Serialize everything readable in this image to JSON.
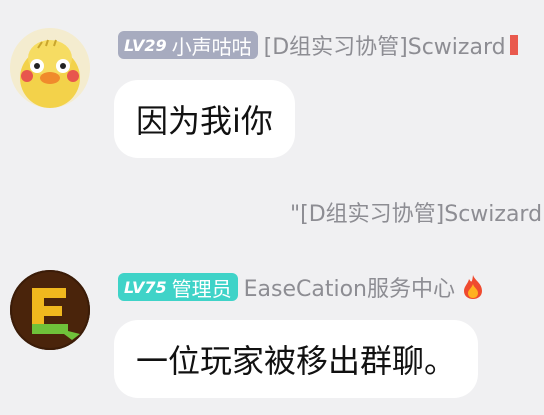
{
  "messages": [
    {
      "level": "LV29",
      "title": "小声咕咕",
      "nickname": "[D组实习协管]Scwizard",
      "text": "因为我i你",
      "avatar": "duck-avatar"
    },
    {
      "level": "LV75",
      "title": "管理员",
      "nickname": "EaseCation服务中心",
      "text": "一位玩家被移出群聊。",
      "avatar": "easecation-logo-avatar"
    }
  ],
  "system_notice": "\"[D组实习协管]Scwizard",
  "colors": {
    "background": "#f0f0f2",
    "badge_gray": "#a7abbf",
    "badge_teal": "#3fd3c8",
    "nickname": "#8d8d93"
  },
  "icons": [
    "fire-icon",
    "duck-avatar",
    "easecation-logo-avatar"
  ]
}
